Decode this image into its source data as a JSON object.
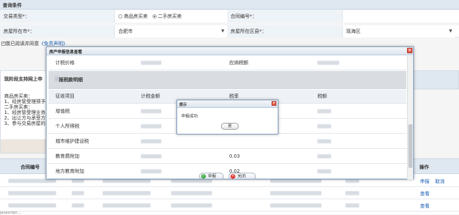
{
  "page": {
    "header": "查询条件",
    "form": {
      "trade_type_label": "交易类型*：",
      "trade_options": [
        "商品房买卖",
        "二手房买卖"
      ],
      "contract_label": "合同编号*：",
      "city_label": "房屋所在市*：",
      "city_value": "合肥市",
      "district_label": "房屋所在区县*：",
      "district_value": "瑶海区"
    },
    "agree": {
      "text": "我已阅读并同意",
      "link": "《免责声明》"
    },
    "left_panel": {
      "title": "现阶段支持网上申",
      "lines": [
        "商品房买卖：",
        "1、经房管受理预予",
        "二手房买卖：",
        "1、经房管受理业务",
        "2、出让方与承受方",
        "3、参与交易房屋的"
      ]
    },
    "table": {
      "col_contract": "合同编号",
      "col_action": "操作",
      "row1_links": [
        "申报",
        "取消"
      ],
      "row2_link": "查看",
      "row3_link": "查看"
    },
    "status": "javascript:..."
  },
  "dialog": {
    "title": "房产申报信息查看",
    "rows_top": [
      {
        "label": "计税价格",
        "label2": "应纳税额"
      }
    ],
    "section_title": "报税款明细",
    "header": [
      "征收项目",
      "计税金额",
      "税率",
      "税额"
    ],
    "items": [
      {
        "name": "增值税",
        "rate": ""
      },
      {
        "name": "个人所得税",
        "rate": ""
      },
      {
        "name": "城市维护建设税",
        "rate": ""
      },
      {
        "name": "教育费附加",
        "rate": "0.03"
      },
      {
        "name": "地方教育附加",
        "rate": "0.02"
      }
    ],
    "btn_submit": "申报",
    "btn_close": "关闭"
  },
  "popup": {
    "title": "提示",
    "message": "申报成功",
    "ok": "是"
  }
}
